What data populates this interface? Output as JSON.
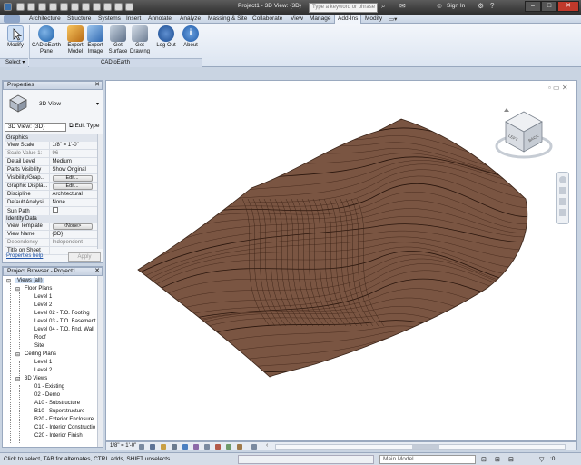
{
  "titlebar": {
    "title": "Project1 - 3D View: {3D}",
    "search_placeholder": "Type a keyword or phrase",
    "sign_in": "Sign In"
  },
  "tabs": [
    "Architecture",
    "Structure",
    "Systems",
    "Insert",
    "Annotate",
    "Analyze",
    "Massing & Site",
    "Collaborate",
    "View",
    "Manage",
    "Add-Ins",
    "Modify"
  ],
  "active_tab": "Add-Ins",
  "ribbon": {
    "buttons": [
      {
        "label": "Modify",
        "icon": "cursor-icon"
      },
      {
        "label": "CADtoEarth Pane",
        "icon": "cadtoearth-icon"
      },
      {
        "label": "Export Model",
        "icon": "export-model-icon"
      },
      {
        "label": "Export Image",
        "icon": "export-image-icon"
      },
      {
        "label": "Get Surface",
        "icon": "get-surface-icon"
      },
      {
        "label": "Get Drawing",
        "icon": "get-drawing-icon"
      },
      {
        "label": "Log Out",
        "icon": "log-out-icon"
      },
      {
        "label": "About",
        "icon": "about-icon"
      }
    ],
    "group_select": "Select ▾",
    "group_cad": "CADtoEarth"
  },
  "properties": {
    "title": "Properties",
    "type_name": "3D View",
    "selector": "3D View: {3D}",
    "edit_type": "Edit Type",
    "section_graphics": "Graphics",
    "graphics": [
      {
        "k": "View Scale",
        "v": "1/8\" = 1'-0\""
      },
      {
        "k": "Scale Value    1:",
        "v": "96"
      },
      {
        "k": "Detail Level",
        "v": "Medium"
      },
      {
        "k": "Parts Visibility",
        "v": "Show Original"
      },
      {
        "k": "Visibility/Grap...",
        "v": "Edit..."
      },
      {
        "k": "Graphic Displa...",
        "v": "Edit..."
      },
      {
        "k": "Discipline",
        "v": "Architectural"
      },
      {
        "k": "Default Analysi...",
        "v": "None"
      },
      {
        "k": "Sun Path",
        "v": ""
      }
    ],
    "section_identity": "Identity Data",
    "identity": [
      {
        "k": "View Template",
        "v": "<None>"
      },
      {
        "k": "View Name",
        "v": "{3D}"
      },
      {
        "k": "Dependency",
        "v": "Independent"
      },
      {
        "k": "Title on Sheet",
        "v": ""
      }
    ],
    "help_link": "Properties help",
    "apply": "Apply"
  },
  "browser": {
    "title": "Project Browser - Project1",
    "root": "Views (all)",
    "floor_plans": "Floor Plans",
    "floor_items": [
      "Level 1",
      "Level 2",
      "Level 02 - T.O. Footing",
      "Level 03 - T.O. Basement",
      "Level 04 - T.O. Fnd. Wall",
      "Roof",
      "Site"
    ],
    "ceiling_plans": "Ceiling Plans",
    "ceiling_items": [
      "Level 1",
      "Level 2"
    ],
    "views_3d": "3D Views",
    "views_3d_items": [
      "01 - Existing",
      "02 - Demo",
      "A10 - Substructure",
      "B10 - Superstructure",
      "B20 - Exterior Enclosure",
      "C10 - Interior Constructio",
      "C20 - Interior Finish"
    ]
  },
  "viewcube": {
    "left": "LEFT",
    "back": "BACK"
  },
  "viewbar": {
    "scale": "1/8\" = 1'-0\""
  },
  "statusbar": {
    "hint": "Click to select, TAB for alternates, CTRL adds, SHIFT unselects.",
    "model": "Main Model",
    "count": ":0"
  },
  "colors": {
    "terrain": "#7a5542",
    "accent": "#3a78c8"
  }
}
